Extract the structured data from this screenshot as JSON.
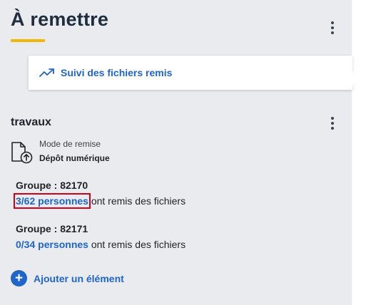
{
  "header": {
    "title": "À remettre",
    "menu_icon": "more-vertical-icon"
  },
  "tooltip": {
    "icon": "trending-up-icon",
    "label": "Suivi des fichiers remis"
  },
  "assignment": {
    "title": "travaux",
    "menu_icon": "more-vertical-icon",
    "submission_icon": "file-upload-icon",
    "mode_label": "Mode de remise",
    "mode_value": "Dépôt numérique",
    "groups": [
      {
        "title": "Groupe : 82170",
        "people": "3/62 personnes",
        "suffix": " ont remis des fichiers"
      },
      {
        "title": "Groupe : 82171",
        "people": "0/34 personnes",
        "suffix": " ont remis des fichiers"
      }
    ]
  },
  "add_item": {
    "icon": "plus-circle-icon",
    "label": "Ajouter un élément"
  },
  "colors": {
    "accent": "#1f64c8",
    "underline": "#f2b705",
    "panel_bg": "#e9ebef",
    "highlight_border": "#d0021b"
  }
}
